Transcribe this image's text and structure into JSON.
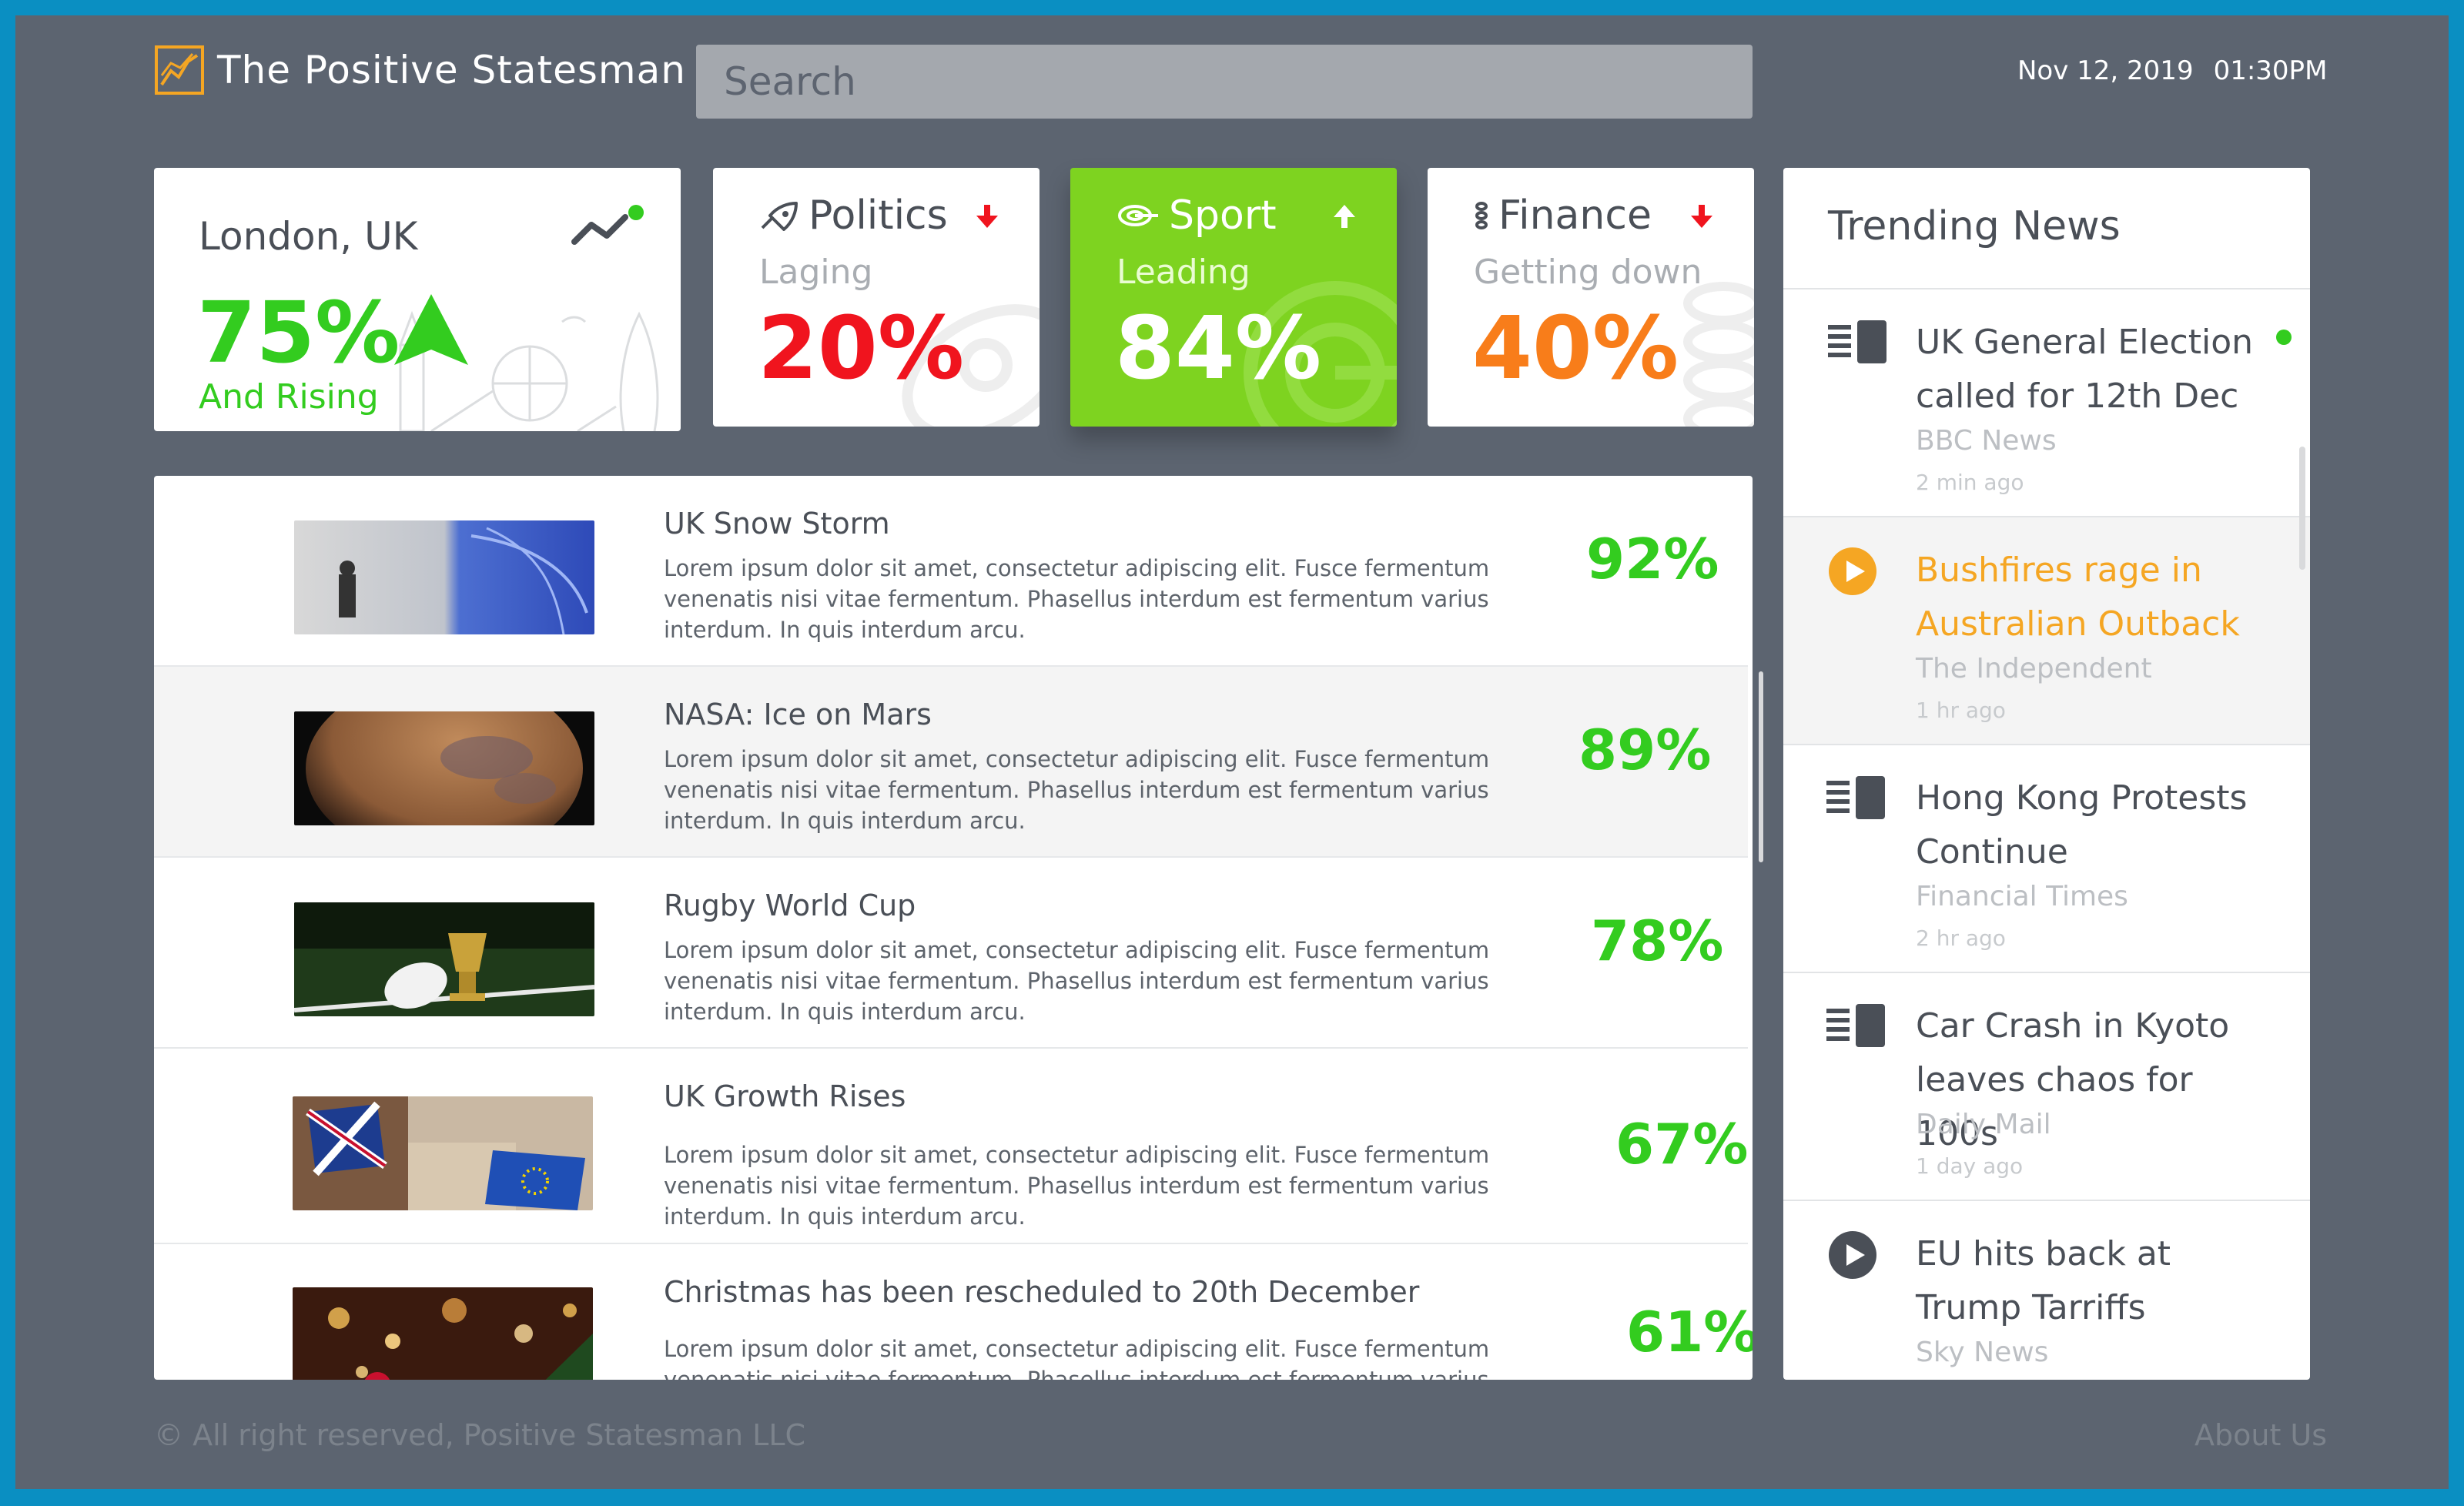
{
  "header": {
    "app_title": "The Positive Statesman",
    "search_placeholder": "Search",
    "date": "Nov 12, 2019",
    "time": "01:30PM"
  },
  "weather": {
    "city": "London, UK",
    "percent": "75%",
    "subtitle": "And Rising",
    "status_color": "#33cc1f"
  },
  "categories": [
    {
      "name": "Politics",
      "status": "Laging",
      "percent": "20%",
      "trend": "down",
      "color": "#f0141e"
    },
    {
      "name": "Sport",
      "status": "Leading",
      "percent": "84%",
      "trend": "up",
      "color": "#ffffff",
      "background": "#7ed320"
    },
    {
      "name": "Finance",
      "status": "Getting down",
      "percent": "40%",
      "trend": "down",
      "color": "#f87d1a"
    }
  ],
  "articles": [
    {
      "title": "UK Snow Storm",
      "body": "Lorem ipsum dolor sit amet, consectetur adipiscing elit. Fusce fermentum venenatis nisi vitae fermentum. Phasellus interdum est fermentum varius interdum. In quis interdum arcu.",
      "score": "92%"
    },
    {
      "title": "NASA: Ice on Mars",
      "body": "Lorem ipsum dolor sit amet, consectetur adipiscing elit. Fusce fermentum venenatis nisi vitae fermentum. Phasellus interdum est fermentum varius interdum. In quis interdum arcu.",
      "score": "89%"
    },
    {
      "title": "Rugby World Cup",
      "body": "Lorem ipsum dolor sit amet, consectetur adipiscing elit. Fusce fermentum venenatis nisi vitae fermentum. Phasellus interdum est fermentum varius interdum. In quis interdum arcu.",
      "score": "78%"
    },
    {
      "title": "UK Growth Rises",
      "body": "Lorem ipsum dolor sit amet, consectetur adipiscing elit. Fusce fermentum venenatis nisi vitae fermentum. Phasellus interdum est fermentum varius interdum. In quis interdum arcu.",
      "score": "67%"
    },
    {
      "title": "Christmas has been rescheduled to 20th December",
      "body": "Lorem ipsum dolor sit amet, consectetur adipiscing elit. Fusce fermentum venenatis nisi vitae fermentum. Phasellus interdum est fermentum varius interdum. In quis interdum arcu.",
      "score": "61%"
    }
  ],
  "trending": {
    "title": "Trending News",
    "items": [
      {
        "title": "UK General Election called for 12th Dec",
        "source": "BBC News",
        "time": "2 min ago",
        "icon": "article-icon",
        "unread": true
      },
      {
        "title": "Bushfires rage in Australian Outback",
        "source": "The Independent",
        "time": "1 hr ago",
        "icon": "play-icon",
        "active": true
      },
      {
        "title": "Hong Kong Protests Continue",
        "source": "Financial Times",
        "time": "2 hr ago",
        "icon": "article-icon"
      },
      {
        "title": "Car Crash in Kyoto leaves chaos for 100s",
        "source": "Daily Mail",
        "time": "1 day ago",
        "icon": "article-icon"
      },
      {
        "title": "EU hits back at Trump Tarriffs",
        "source": "Sky News",
        "time": "",
        "icon": "play-icon"
      }
    ]
  },
  "footer": {
    "copyright": "© All right reserved, Positive Statesman LLC",
    "about": "About Us"
  },
  "colors": {
    "background": "#5c6470",
    "accent_green": "#33cc1f",
    "accent_orange": "#f5a623",
    "border": "#0a8fc2"
  }
}
